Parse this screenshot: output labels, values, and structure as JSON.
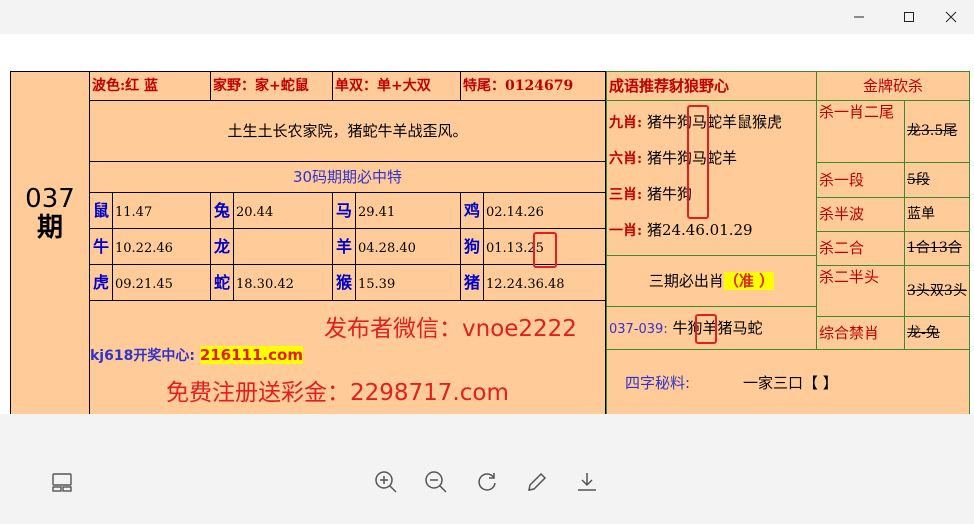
{
  "window": {
    "minimize_glyph": "—",
    "maximize_glyph": "☐",
    "close_glyph": "✕"
  },
  "sheet": {
    "issue_no": "037",
    "issue_suffix": "期",
    "row1": {
      "bose": "波色:红 蓝",
      "jiaye": "家野：家+蛇鼠",
      "danshuang": "单双：单+大双",
      "tewei": "特尾：0124679"
    },
    "poem": "土生土长农家院，猪蛇牛羊战歪风。",
    "slogan30": "30码期期必中特",
    "zodiac": [
      {
        "name": "鼠",
        "nums": "11.47"
      },
      {
        "name": "兔",
        "nums": "20.44"
      },
      {
        "name": "马",
        "nums": "29.41"
      },
      {
        "name": "鸡",
        "nums": "02.14.26"
      },
      {
        "name": "牛",
        "nums": "10.22.46"
      },
      {
        "name": "龙",
        "nums": ""
      },
      {
        "name": "羊",
        "nums": "04.28.40"
      },
      {
        "name": "狗",
        "nums": "01.13.",
        "highlight": "25"
      },
      {
        "name": "虎",
        "nums": "09.21.45"
      },
      {
        "name": "蛇",
        "nums": "18.30.42"
      },
      {
        "name": "猴",
        "nums": "15.39"
      },
      {
        "name": "猪",
        "nums": "12.24.36.48"
      }
    ],
    "wechat": "发布者微信：vnoe2222",
    "kj_label": "kj618开奖中心:",
    "kj_site": "216111.com",
    "free": "免费注册送彩金：2298717.com",
    "recommend_header": "成语推荐豺狼野心",
    "nine_label": "九肖:",
    "nine_val": "猪牛狗马蛇羊鼠猴虎",
    "six_label": "六肖:",
    "six_val": "猪牛狗马蛇羊",
    "three_label": "三肖:",
    "three_val": "猪牛狗",
    "one_label": "一肖:",
    "one_val": "猪24.46.01.29",
    "three_period": "三期必出肖",
    "three_period_tag": "（准 ）",
    "range_label": "037-039:",
    "range_val": "牛狗羊猪马蛇",
    "four_char_label": "四字秘料:",
    "four_char_val": "一家三口【  】",
    "gold_header": "金牌砍杀",
    "kill": [
      {
        "label": "杀一肖二尾",
        "value": "龙3.5尾"
      },
      {
        "label": "杀一段",
        "value": "5段"
      },
      {
        "label": "杀半波",
        "value": "蓝单"
      },
      {
        "label": "杀二合",
        "value": "1合13合"
      },
      {
        "label": "杀二半头",
        "value": "3头双3头"
      },
      {
        "label": "综合禁肖",
        "value": "龙-兔"
      }
    ]
  },
  "toolbar": {
    "zoom_in": "zoom-in",
    "zoom_out": "zoom-out",
    "rotate": "rotate",
    "edit": "edit",
    "download": "download"
  },
  "colors": {
    "sheet_bg": "#ffcc99",
    "label_red": "#c00000",
    "zodiac_blue": "#0000cc",
    "highlight_box": "#e0201f",
    "yellow_highlight": "#ffff00"
  }
}
